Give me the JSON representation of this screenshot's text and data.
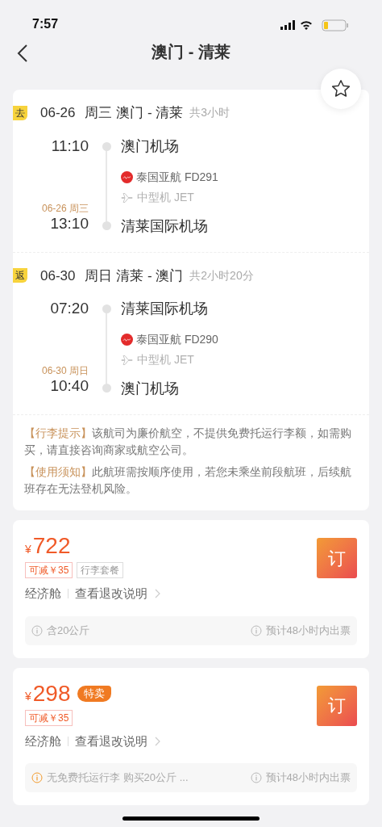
{
  "status_bar": {
    "time": "7:57"
  },
  "nav": {
    "title": "澳门 - 清莱"
  },
  "favorite": {
    "on": false
  },
  "legs": [
    {
      "tag": "去",
      "date": "06-26",
      "weekday": "周三",
      "route": "澳门 - 清莱",
      "duration": "共3小时",
      "dep_time": "11:10",
      "dep_airport": "澳门机场",
      "flight": "泰国亚航 FD291",
      "aircraft": "中型机 JET",
      "arr_date": "06-26 周三",
      "arr_time": "13:10",
      "arr_airport": "清莱国际机场"
    },
    {
      "tag": "返",
      "date": "06-30",
      "weekday": "周日",
      "route": "清莱 - 澳门",
      "duration": "共2小时20分",
      "dep_time": "07:20",
      "dep_airport": "清莱国际机场",
      "flight": "泰国亚航 FD290",
      "aircraft": "中型机 JET",
      "arr_date": "06-30 周日",
      "arr_time": "10:40",
      "arr_airport": "澳门机场"
    }
  ],
  "notices": [
    {
      "label": "【行李提示】",
      "text": "该航司为廉价航空，不提供免费托运行李额，如需购买，请直接咨询商家或航空公司。"
    },
    {
      "label": "【使用须知】",
      "text": "此航班需按顺序使用，若您未乘坐前段航班，后续航班存在无法登机风险。"
    }
  ],
  "offers": [
    {
      "currency": "¥",
      "price": "722",
      "tags": [
        {
          "kind": "discount",
          "text": "可减￥35"
        },
        {
          "kind": "package",
          "text": "行李套餐"
        }
      ],
      "cabin": "经济舱",
      "rules_link": "查看退改说明",
      "book": "订",
      "notes": [
        {
          "warning": false,
          "text": "含20公斤"
        },
        {
          "warning": false,
          "text": "预计48小时内出票"
        }
      ]
    },
    {
      "currency": "¥",
      "price": "298",
      "badge": "特卖",
      "tags": [
        {
          "kind": "discount",
          "text": "可减￥35"
        }
      ],
      "cabin": "经济舱",
      "rules_link": "查看退改说明",
      "book": "订",
      "notes": [
        {
          "warning": true,
          "text": "无免费托运行李 购买20公斤 ..."
        },
        {
          "warning": false,
          "text": "预计48小时内出票"
        }
      ]
    }
  ]
}
